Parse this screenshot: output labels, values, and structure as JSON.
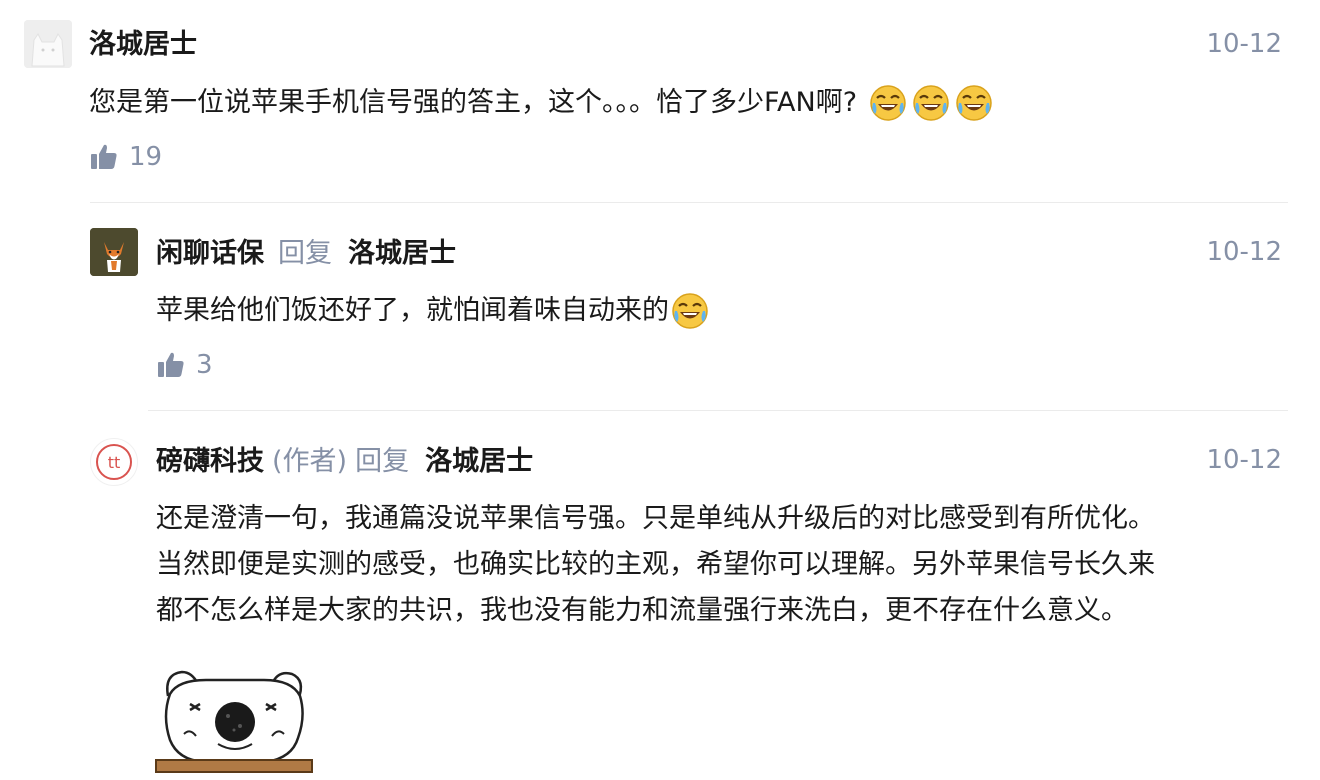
{
  "comments": [
    {
      "author": "洛城居士",
      "time": "10-12",
      "content": "您是第一位说苹果手机信号强的答主，这个。。。恰了多少FAN啊?",
      "likes": "19",
      "avatar_icon": "default-avatar-icon",
      "emoji_icon": "laughing-tears-emoji-icon"
    },
    {
      "author": "闲聊话保",
      "reply_label": "回复",
      "reply_to": "洛城居士",
      "time": "10-12",
      "content": "苹果给他们饭还好了，就怕闻着味自动来的",
      "likes": "3",
      "avatar_icon": "fox-avatar-icon",
      "emoji_icon": "laughing-tears-emoji-icon"
    },
    {
      "author": "磅礴科技",
      "author_tag": "(作者)",
      "reply_label": "回复",
      "reply_to": "洛城居士",
      "time": "10-12",
      "content_lines": [
        "还是澄清一句，我通篇没说苹果信号强。只是单纯从升级后的对比感受到有所优化。",
        "当然即便是实测的感受，也确实比较的主观，希望你可以理解。另外苹果信号长久来",
        "都不怎么样是大家的共识，我也没有能力和流量强行来洗白，更不存在什么意义。"
      ],
      "avatar_icon": "tt-logo-avatar-icon",
      "avatar_logo_text": "tt",
      "sticker_icon": "pig-sticker-icon"
    }
  ],
  "colors": {
    "text": "#1a1a1a",
    "meta": "#8590a6",
    "divider": "#ebebeb",
    "logo_red": "#d9534f"
  }
}
